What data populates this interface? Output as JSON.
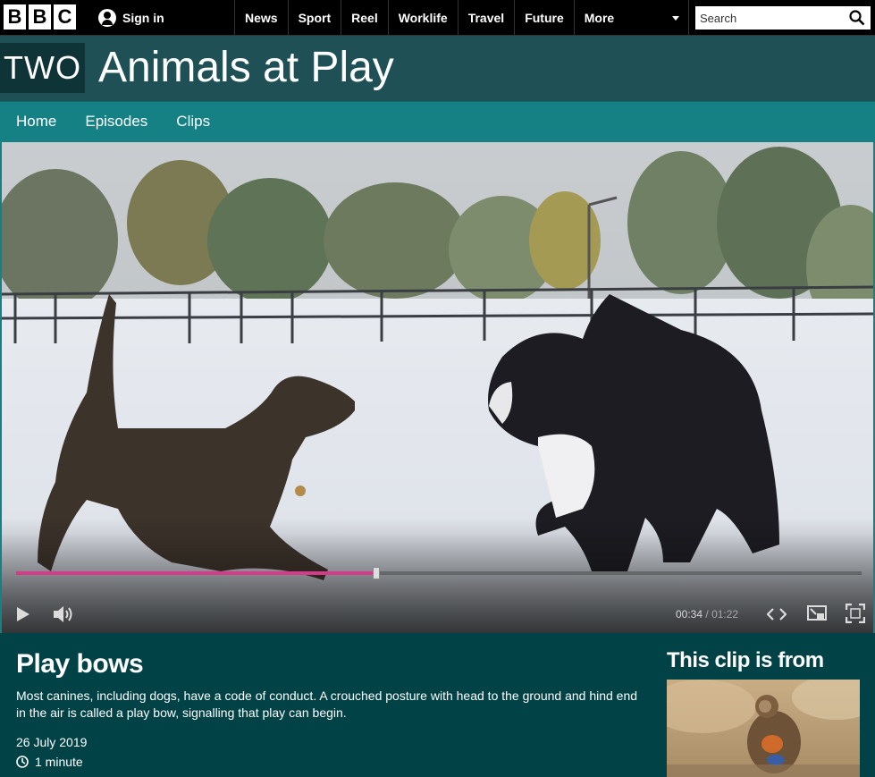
{
  "topbar": {
    "logo_letters": [
      "B",
      "B",
      "C"
    ],
    "signin_label": "Sign in",
    "nav": [
      "News",
      "Sport",
      "Reel",
      "Worklife",
      "Travel",
      "Future"
    ],
    "more_label": "More",
    "search_placeholder": "Search"
  },
  "brand": {
    "channel": "TWO",
    "title": "Animals at Play"
  },
  "subnav": {
    "items": [
      "Home",
      "Episodes",
      "Clips"
    ]
  },
  "player": {
    "progress_fraction": 0.426,
    "current_time": "00:34",
    "separator": "/",
    "duration": "01:22",
    "accent_color": "#d63a8a"
  },
  "clip": {
    "title": "Play bows",
    "description": "Most canines, including dogs, have a code of conduct. A crouched posture with head to the ground and hind end in the air is called a play bow, signalling that play can begin.",
    "date": "26 July 2019",
    "duration": "1 minute"
  },
  "from": {
    "heading": "This clip is from"
  },
  "colors": {
    "brand_header": "#1e5055",
    "subnav": "#158185",
    "page_bg": "#004246"
  }
}
